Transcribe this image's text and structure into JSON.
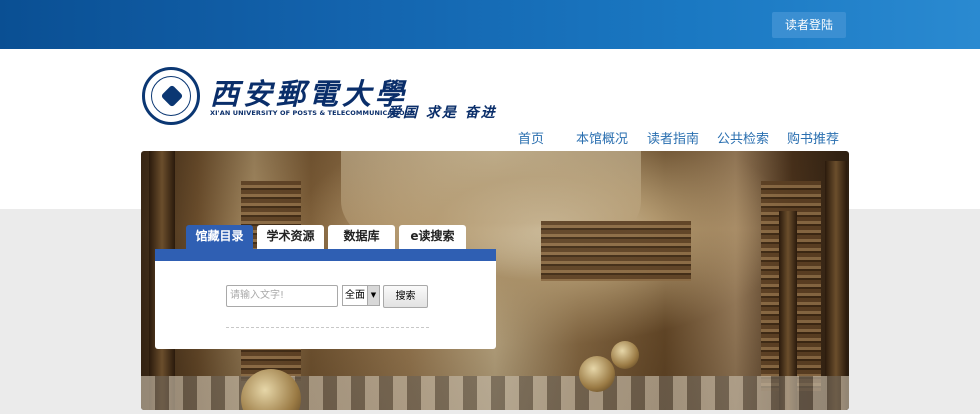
{
  "topbar": {
    "login_label": "读者登陆"
  },
  "header": {
    "university_name": "西安郵電大學",
    "university_en": "XI'AN UNIVERSITY OF POSTS & TELECOMMUNICATIONS",
    "motto": "爱国 求是 奋进"
  },
  "nav": {
    "items": [
      {
        "label": "首页"
      },
      {
        "label": "本馆概况"
      },
      {
        "label": "读者指南"
      },
      {
        "label": "公共检索"
      },
      {
        "label": "购书推荐"
      }
    ]
  },
  "search": {
    "tabs": [
      {
        "label": "馆藏目录",
        "active": true
      },
      {
        "label": "学术资源",
        "active": false
      },
      {
        "label": "数据库",
        "active": false
      },
      {
        "label": "e读搜索",
        "active": false
      }
    ],
    "placeholder": "请输入文字!",
    "scope_selected": "全面",
    "button_label": "搜索"
  },
  "colors": {
    "topbar_blue": "#1363ad",
    "tab_active": "#2f5fb3",
    "nav_text": "#2a6fb0",
    "logo_navy": "#0a2e6a"
  },
  "icons": {
    "logo": "university-seal-icon",
    "select_arrow": "dropdown-arrow-icon"
  }
}
